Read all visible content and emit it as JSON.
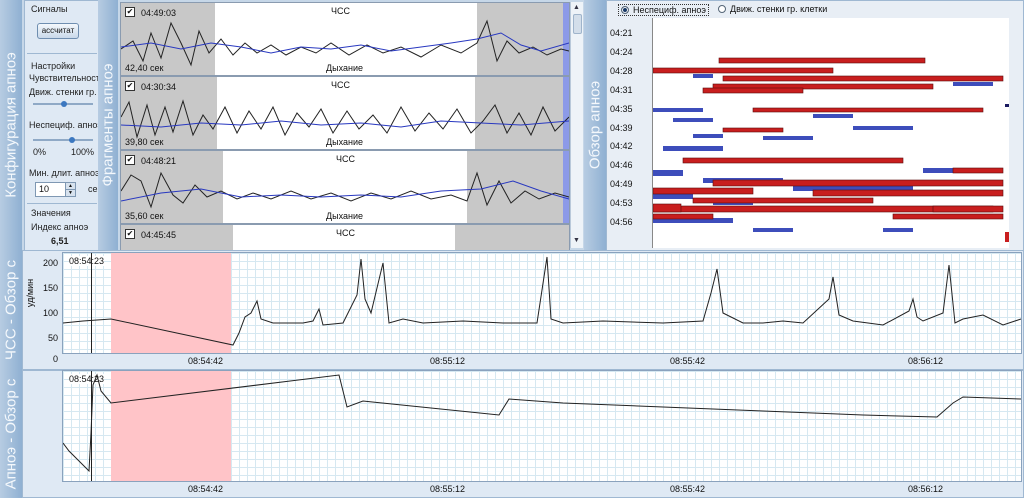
{
  "left_tabs": {
    "config": "Конфигурация апноэ",
    "fragments": "Фрагменты апноэ",
    "overview": "Обзор апноэ",
    "hr_review": "ЧСС - Обзор с",
    "apnea_review": "Апноэ - Обзор с"
  },
  "config_panel": {
    "signals_label": "Сигналы",
    "signals_button": "ассчитат",
    "settings_label": "Настройки",
    "sensitivity_label": "Чувствительность",
    "chest_label": "Движ. стенки гр.",
    "nonspec_label": "Неспециф. апноэ",
    "range_min": "0%",
    "range_max": "100%",
    "min_duration_label": "Мин. длит. апноэ",
    "min_duration_value": "10",
    "min_duration_unit": "сек",
    "values_label": "Значения",
    "index_label": "Индекс апноэ",
    "index_value": "6,51"
  },
  "fragments": [
    {
      "time": "04:49:03",
      "hr_label": "ЧСС",
      "breath_label": "Дыхание",
      "duration": "42,40 сек",
      "checked": "✔"
    },
    {
      "time": "04:30:34",
      "hr_label": "ЧСС",
      "breath_label": "Дыхание",
      "duration": "39,80 сек",
      "checked": "✔"
    },
    {
      "time": "04:48:21",
      "hr_label": "ЧСС",
      "breath_label": "Дыхание",
      "duration": "35,60 сек",
      "checked": "✔"
    },
    {
      "time": "04:45:45",
      "hr_label": "ЧСС",
      "breath_label": "",
      "duration": "",
      "checked": "✔"
    }
  ],
  "overview": {
    "radio_nonspec": "Неспециф. апноэ",
    "radio_chest": "Движ. стенки гр. клетки",
    "selected": "nonspec",
    "times": [
      "04:21",
      "04:24",
      "04:28",
      "04:31",
      "04:35",
      "04:39",
      "04:42",
      "04:46",
      "04:49",
      "04:53",
      "04:56"
    ],
    "colors": {
      "red": "#c81e1e",
      "blue": "#1c2fb0"
    }
  },
  "hr_chart": {
    "cursor_time": "08:54:23",
    "ylabel": "уд/мин",
    "yticks": [
      "200",
      "150",
      "100",
      "50",
      "0"
    ],
    "xticks": [
      "08:54:42",
      "08:55:12",
      "08:55:42",
      "08:56:12"
    ],
    "highlight_color": "#ffc4c8"
  },
  "apnea_chart": {
    "cursor_time": "08:54:23",
    "xticks": [
      "08:54:42",
      "08:55:12",
      "08:55:42",
      "08:56:12"
    ],
    "highlight_color": "#ffc4c8"
  }
}
